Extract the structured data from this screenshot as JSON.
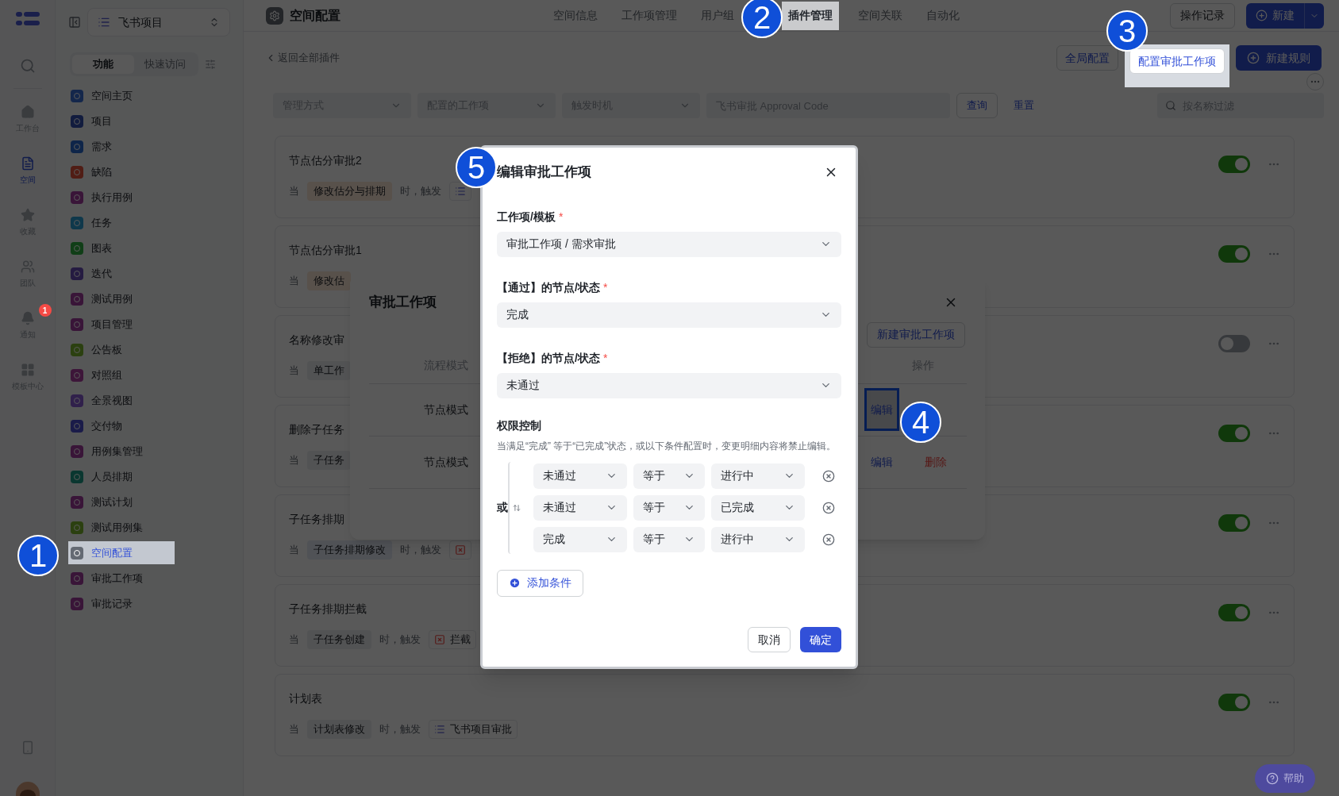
{
  "rail": {
    "items": [
      {
        "label": "工作台",
        "selected": false
      },
      {
        "label": "空间",
        "selected": true
      },
      {
        "label": "收藏",
        "selected": false
      },
      {
        "label": "团队",
        "selected": false
      },
      {
        "label": "通知",
        "selected": false,
        "badge": "1"
      },
      {
        "label": "模板中心",
        "selected": false
      }
    ]
  },
  "sidebar": {
    "project": "飞书项目",
    "tabs": [
      {
        "label": "功能",
        "selected": true
      },
      {
        "label": "快速访问",
        "selected": false
      }
    ],
    "items": [
      {
        "label": "空间主页",
        "selected": false
      },
      {
        "label": "项目",
        "selected": false
      },
      {
        "label": "需求",
        "selected": false
      },
      {
        "label": "缺陷",
        "selected": false
      },
      {
        "label": "执行用例",
        "selected": false
      },
      {
        "label": "任务",
        "selected": false
      },
      {
        "label": "图表",
        "selected": false
      },
      {
        "label": "迭代",
        "selected": false
      },
      {
        "label": "测试用例",
        "selected": false
      },
      {
        "label": "项目管理",
        "selected": false
      },
      {
        "label": "公告板",
        "selected": false
      },
      {
        "label": "对照组",
        "selected": false
      },
      {
        "label": "全景视图",
        "selected": false
      },
      {
        "label": "交付物",
        "selected": false
      },
      {
        "label": "用例集管理",
        "selected": false
      },
      {
        "label": "人员排期",
        "selected": false
      },
      {
        "label": "测试计划",
        "selected": false
      },
      {
        "label": "测试用例集",
        "selected": false
      },
      {
        "label": "空间配置",
        "selected": true
      },
      {
        "label": "审批工作项",
        "selected": false
      },
      {
        "label": "审批记录",
        "selected": false
      }
    ]
  },
  "header": {
    "title": "空间配置",
    "tabs": [
      {
        "label": "空间信息",
        "selected": false
      },
      {
        "label": "工作项管理",
        "selected": false
      },
      {
        "label": "用户组",
        "selected": false
      },
      {
        "label": "插件管理",
        "selected": true
      },
      {
        "label": "空间关联",
        "selected": false
      },
      {
        "label": "自动化",
        "selected": false
      }
    ],
    "actions": [
      {
        "label": "操作记录",
        "kind": "outline"
      },
      {
        "label": "新建",
        "kind": "primary"
      }
    ]
  },
  "toolbar": {
    "back": "返回全部插件",
    "buttons": [
      {
        "label": "全局配置",
        "kind": "outline",
        "highlighted": false
      },
      {
        "label": "配置审批工作项",
        "kind": "outline",
        "highlighted": true
      },
      {
        "label": "新建规则",
        "kind": "primary",
        "highlighted": false
      }
    ]
  },
  "filters": {
    "selects": [
      {
        "placeholder": "管理方式"
      },
      {
        "placeholder": "配置的工作项"
      },
      {
        "placeholder": "触发时机"
      }
    ],
    "code": {
      "placeholder": "飞书审批 Approval Code"
    },
    "query": "查询",
    "reset": "重置",
    "search": {
      "placeholder": "按名称过滤"
    }
  },
  "rules": [
    {
      "title": "节点估分审批2",
      "when": "当",
      "event": "修改估分与排期",
      "trigger": "时，触发",
      "action": {
        "kind": "approval"
      },
      "on": true
    },
    {
      "title": "节点估分审批1",
      "when": "当",
      "event": "修改估",
      "on": true
    },
    {
      "title": "名称修改审",
      "when": "当",
      "event": "单工作",
      "on": false
    },
    {
      "title": "删除子任务",
      "when": "当",
      "event": "子任务",
      "on": true
    },
    {
      "title": "子任务排期",
      "when": "当",
      "event": "子任务排期修改",
      "trigger": "时，触发",
      "action": {
        "kind": "intercept"
      },
      "on": true
    },
    {
      "title": "子任务排期拦截",
      "when": "当",
      "event": "子任务创建",
      "trigger": "时，触发",
      "action": {
        "kind": "intercept",
        "label": "拦截"
      },
      "on": true
    },
    {
      "title": "计划表",
      "when": "当",
      "event": "计划表修改",
      "trigger": "时，触发",
      "action": {
        "kind": "approval",
        "label": "飞书项目审批"
      },
      "on": true
    }
  ],
  "approval_dialog": {
    "title": "审批工作项",
    "new_button": "新建审批工作项",
    "columns": [
      "流程模式",
      "操作"
    ],
    "rows": [
      {
        "mode": "节点模式",
        "actions": [
          {
            "label": "编辑",
            "kind": "edit",
            "highlighted": true
          }
        ]
      },
      {
        "mode": "节点模式",
        "actions": [
          {
            "label": "编辑",
            "kind": "edit",
            "highlighted": false
          },
          {
            "label": "删除",
            "kind": "delete",
            "highlighted": false
          }
        ]
      }
    ]
  },
  "edit_dialog": {
    "title": "编辑审批工作项",
    "fields": [
      {
        "label": "工作项/模板",
        "required_mark": "*",
        "value": "审批工作项 / 需求审批"
      },
      {
        "label": "【通过】的节点/状态",
        "required_mark": "*",
        "value": "完成"
      },
      {
        "label": "【拒绝】的节点/状态",
        "required_mark": "*",
        "value": "未通过"
      }
    ],
    "permission": {
      "title": "权限控制",
      "description": "当满足“完成” 等于“已完成”状态，或以下条件配置时，变更明细内容将禁止编辑。",
      "logic": "或",
      "conditions": [
        {
          "field": "未通过",
          "operator": "等于",
          "value": "进行中"
        },
        {
          "field": "未通过",
          "operator": "等于",
          "value": "已完成"
        },
        {
          "field": "完成",
          "operator": "等于",
          "value": "进行中"
        }
      ],
      "add": "添加条件"
    },
    "buttons": [
      {
        "label": "取消",
        "kind": "secondary"
      },
      {
        "label": "确定",
        "kind": "primary"
      }
    ]
  },
  "annotations": [
    "1",
    "2",
    "3",
    "4",
    "5"
  ],
  "help": "帮助"
}
